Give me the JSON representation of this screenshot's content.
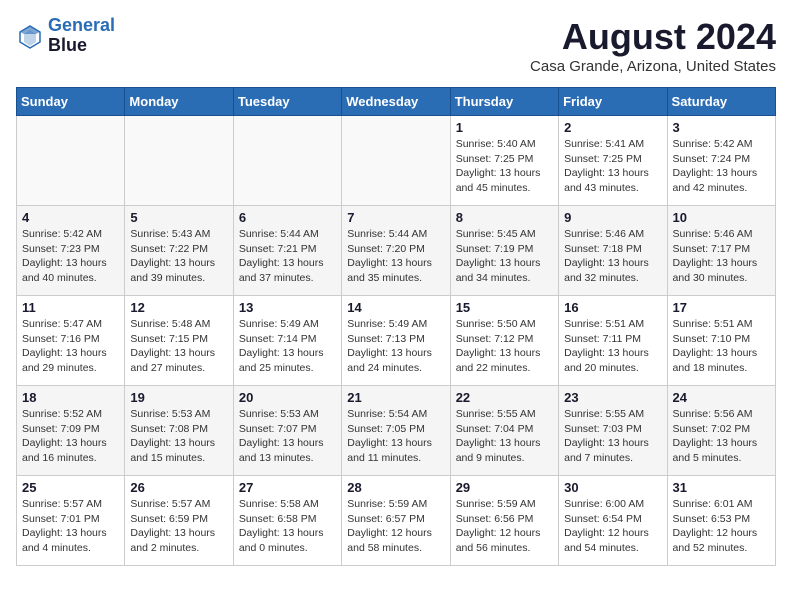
{
  "header": {
    "logo_line1": "General",
    "logo_line2": "Blue",
    "title": "August 2024",
    "subtitle": "Casa Grande, Arizona, United States"
  },
  "columns": [
    "Sunday",
    "Monday",
    "Tuesday",
    "Wednesday",
    "Thursday",
    "Friday",
    "Saturday"
  ],
  "weeks": [
    [
      {
        "day": "",
        "info": ""
      },
      {
        "day": "",
        "info": ""
      },
      {
        "day": "",
        "info": ""
      },
      {
        "day": "",
        "info": ""
      },
      {
        "day": "1",
        "info": "Sunrise: 5:40 AM\nSunset: 7:25 PM\nDaylight: 13 hours\nand 45 minutes."
      },
      {
        "day": "2",
        "info": "Sunrise: 5:41 AM\nSunset: 7:25 PM\nDaylight: 13 hours\nand 43 minutes."
      },
      {
        "day": "3",
        "info": "Sunrise: 5:42 AM\nSunset: 7:24 PM\nDaylight: 13 hours\nand 42 minutes."
      }
    ],
    [
      {
        "day": "4",
        "info": "Sunrise: 5:42 AM\nSunset: 7:23 PM\nDaylight: 13 hours\nand 40 minutes."
      },
      {
        "day": "5",
        "info": "Sunrise: 5:43 AM\nSunset: 7:22 PM\nDaylight: 13 hours\nand 39 minutes."
      },
      {
        "day": "6",
        "info": "Sunrise: 5:44 AM\nSunset: 7:21 PM\nDaylight: 13 hours\nand 37 minutes."
      },
      {
        "day": "7",
        "info": "Sunrise: 5:44 AM\nSunset: 7:20 PM\nDaylight: 13 hours\nand 35 minutes."
      },
      {
        "day": "8",
        "info": "Sunrise: 5:45 AM\nSunset: 7:19 PM\nDaylight: 13 hours\nand 34 minutes."
      },
      {
        "day": "9",
        "info": "Sunrise: 5:46 AM\nSunset: 7:18 PM\nDaylight: 13 hours\nand 32 minutes."
      },
      {
        "day": "10",
        "info": "Sunrise: 5:46 AM\nSunset: 7:17 PM\nDaylight: 13 hours\nand 30 minutes."
      }
    ],
    [
      {
        "day": "11",
        "info": "Sunrise: 5:47 AM\nSunset: 7:16 PM\nDaylight: 13 hours\nand 29 minutes."
      },
      {
        "day": "12",
        "info": "Sunrise: 5:48 AM\nSunset: 7:15 PM\nDaylight: 13 hours\nand 27 minutes."
      },
      {
        "day": "13",
        "info": "Sunrise: 5:49 AM\nSunset: 7:14 PM\nDaylight: 13 hours\nand 25 minutes."
      },
      {
        "day": "14",
        "info": "Sunrise: 5:49 AM\nSunset: 7:13 PM\nDaylight: 13 hours\nand 24 minutes."
      },
      {
        "day": "15",
        "info": "Sunrise: 5:50 AM\nSunset: 7:12 PM\nDaylight: 13 hours\nand 22 minutes."
      },
      {
        "day": "16",
        "info": "Sunrise: 5:51 AM\nSunset: 7:11 PM\nDaylight: 13 hours\nand 20 minutes."
      },
      {
        "day": "17",
        "info": "Sunrise: 5:51 AM\nSunset: 7:10 PM\nDaylight: 13 hours\nand 18 minutes."
      }
    ],
    [
      {
        "day": "18",
        "info": "Sunrise: 5:52 AM\nSunset: 7:09 PM\nDaylight: 13 hours\nand 16 minutes."
      },
      {
        "day": "19",
        "info": "Sunrise: 5:53 AM\nSunset: 7:08 PM\nDaylight: 13 hours\nand 15 minutes."
      },
      {
        "day": "20",
        "info": "Sunrise: 5:53 AM\nSunset: 7:07 PM\nDaylight: 13 hours\nand 13 minutes."
      },
      {
        "day": "21",
        "info": "Sunrise: 5:54 AM\nSunset: 7:05 PM\nDaylight: 13 hours\nand 11 minutes."
      },
      {
        "day": "22",
        "info": "Sunrise: 5:55 AM\nSunset: 7:04 PM\nDaylight: 13 hours\nand 9 minutes."
      },
      {
        "day": "23",
        "info": "Sunrise: 5:55 AM\nSunset: 7:03 PM\nDaylight: 13 hours\nand 7 minutes."
      },
      {
        "day": "24",
        "info": "Sunrise: 5:56 AM\nSunset: 7:02 PM\nDaylight: 13 hours\nand 5 minutes."
      }
    ],
    [
      {
        "day": "25",
        "info": "Sunrise: 5:57 AM\nSunset: 7:01 PM\nDaylight: 13 hours\nand 4 minutes."
      },
      {
        "day": "26",
        "info": "Sunrise: 5:57 AM\nSunset: 6:59 PM\nDaylight: 13 hours\nand 2 minutes."
      },
      {
        "day": "27",
        "info": "Sunrise: 5:58 AM\nSunset: 6:58 PM\nDaylight: 13 hours\nand 0 minutes."
      },
      {
        "day": "28",
        "info": "Sunrise: 5:59 AM\nSunset: 6:57 PM\nDaylight: 12 hours\nand 58 minutes."
      },
      {
        "day": "29",
        "info": "Sunrise: 5:59 AM\nSunset: 6:56 PM\nDaylight: 12 hours\nand 56 minutes."
      },
      {
        "day": "30",
        "info": "Sunrise: 6:00 AM\nSunset: 6:54 PM\nDaylight: 12 hours\nand 54 minutes."
      },
      {
        "day": "31",
        "info": "Sunrise: 6:01 AM\nSunset: 6:53 PM\nDaylight: 12 hours\nand 52 minutes."
      }
    ]
  ]
}
